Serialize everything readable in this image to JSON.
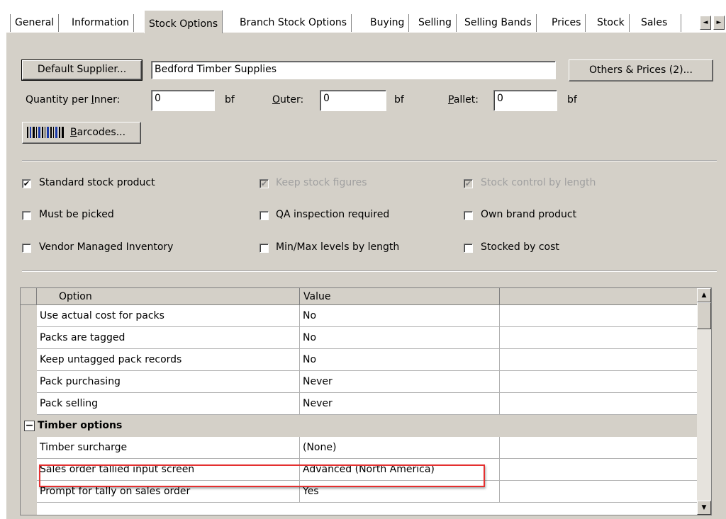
{
  "tabs": {
    "items": [
      "General",
      "Information",
      "Stock Options",
      "Branch Stock Options",
      "Buying",
      "Selling",
      "Selling Bands",
      "Prices",
      "Stock",
      "Sales"
    ],
    "active": "Stock Options"
  },
  "supplier": {
    "button_label": "Default Supplier...",
    "value": "Bedford Timber Supplies",
    "others_button": "Others & Prices (2)..."
  },
  "quantities": {
    "inner_label_pre": "Quantity per ",
    "inner_label_key": "I",
    "inner_label_post": "nner:",
    "inner_value": "0",
    "inner_unit": "bf",
    "outer_label_key": "O",
    "outer_label_post": "uter:",
    "outer_value": "0",
    "outer_unit": "bf",
    "pallet_label_key": "P",
    "pallet_label_post": "allet:",
    "pallet_value": "0",
    "pallet_unit": "bf"
  },
  "barcodes": {
    "label_key": "B",
    "label_post": "arcodes..."
  },
  "checkboxes": [
    {
      "label": "Standard stock product",
      "checked": true,
      "disabled": false
    },
    {
      "label": "Keep stock figures",
      "checked": true,
      "disabled": true
    },
    {
      "label": "Stock control by length",
      "checked": true,
      "disabled": true
    },
    {
      "label": "Must be picked",
      "checked": false,
      "disabled": false
    },
    {
      "label": "QA inspection required",
      "checked": false,
      "disabled": false
    },
    {
      "label": "Own brand product",
      "checked": false,
      "disabled": false
    },
    {
      "label": "Vendor Managed Inventory",
      "checked": false,
      "disabled": false
    },
    {
      "label": "Min/Max levels by length",
      "checked": false,
      "disabled": false
    },
    {
      "label": "Stocked by cost",
      "checked": false,
      "disabled": false
    }
  ],
  "grid": {
    "headers": {
      "option": "Option",
      "value": "Value",
      "extra": ""
    },
    "rows": [
      {
        "option": "Use actual cost for packs",
        "value": "No"
      },
      {
        "option": "Packs are tagged",
        "value": "No"
      },
      {
        "option": "Keep untagged pack records",
        "value": "No"
      },
      {
        "option": "Pack purchasing",
        "value": "Never"
      },
      {
        "option": "Pack selling",
        "value": "Never"
      }
    ],
    "group": {
      "title": "Timber options",
      "expander": "−"
    },
    "group_rows": [
      {
        "option": "Timber surcharge",
        "value": "(None)"
      },
      {
        "option": "Sales order tallied input screen",
        "value": "Advanced (North America)"
      },
      {
        "option": "Prompt for tally on sales order",
        "value": "Yes"
      }
    ]
  },
  "icons": {
    "check": "✔",
    "tab_left": "◄",
    "tab_right": "►",
    "scroll_up": "▲",
    "scroll_down": "▼"
  },
  "colors": {
    "highlight": "#e53030",
    "panel": "#d4d0c8"
  }
}
